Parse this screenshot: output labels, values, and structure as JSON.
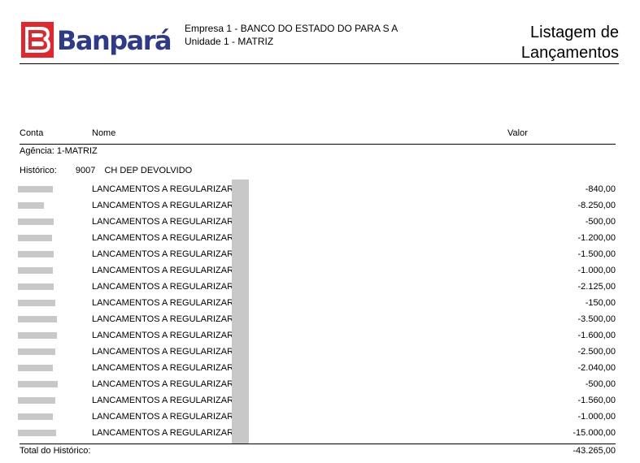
{
  "header": {
    "logo_text": "Banpará",
    "empresa_label": "Empresa 1 - ",
    "empresa_value": "BANCO DO ESTADO DO PARA S A",
    "unidade_label": "Unidade 1 - ",
    "unidade_value": "MATRIZ",
    "title_line1": "Listagem de",
    "title_line2": "Lançamentos"
  },
  "columns": {
    "conta": "Conta",
    "nome": "Nome",
    "valor": "Valor"
  },
  "agencia": "Agência: 1-MATRIZ",
  "historico": {
    "label": "Histórico:",
    "code": "9007",
    "desc": "CH DEP DEVOLVIDO"
  },
  "rows": [
    {
      "nome": "LANCAMENTOS A REGULARIZAR",
      "valor": "-840,00"
    },
    {
      "nome": "LANCAMENTOS A REGULARIZAR",
      "valor": "-8.250,00"
    },
    {
      "nome": "LANCAMENTOS A REGULARIZAR",
      "valor": "-500,00"
    },
    {
      "nome": "LANCAMENTOS A REGULARIZAR",
      "valor": "-1.200,00"
    },
    {
      "nome": "LANCAMENTOS A REGULARIZAR",
      "valor": "-1.500,00"
    },
    {
      "nome": "LANCAMENTOS A REGULARIZAR",
      "valor": "-1.000,00"
    },
    {
      "nome": "LANCAMENTOS A REGULARIZAR",
      "valor": "-2.125,00"
    },
    {
      "nome": "LANCAMENTOS A REGULARIZAR",
      "valor": "-150,00"
    },
    {
      "nome": "LANCAMENTOS A REGULARIZAR",
      "valor": "-3.500,00"
    },
    {
      "nome": "LANCAMENTOS A REGULARIZAR",
      "valor": "-1.600,00"
    },
    {
      "nome": "LANCAMENTOS A REGULARIZAR",
      "valor": "-2.500,00"
    },
    {
      "nome": "LANCAMENTOS A REGULARIZAR",
      "valor": "-2.040,00"
    },
    {
      "nome": "LANCAMENTOS A REGULARIZAR",
      "valor": "-500,00"
    },
    {
      "nome": "LANCAMENTOS A REGULARIZAR",
      "valor": "-1.560,00"
    },
    {
      "nome": "LANCAMENTOS A REGULARIZAR",
      "valor": "-1.000,00"
    },
    {
      "nome": "LANCAMENTOS A REGULARIZAR",
      "valor": "-15.000,00"
    }
  ],
  "total": {
    "label": "Total do Histórico:",
    "value": "-43.265,00"
  },
  "colors": {
    "brand_red": "#e2262b",
    "brand_blue": "#2e3a8c",
    "redaction": "#c8c8c8"
  }
}
